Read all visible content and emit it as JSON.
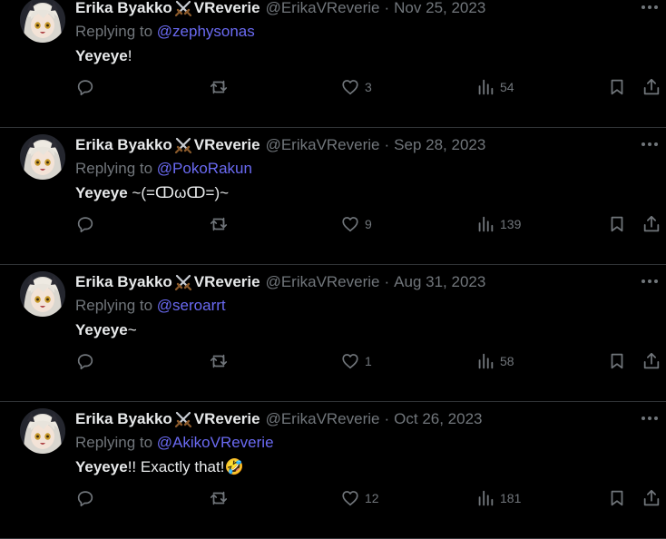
{
  "tweets": [
    {
      "author_name_left": "Erika Byakko",
      "author_name_right": "VReverie",
      "handle": "@ErikaVReverie",
      "separator": "·",
      "date": "Nov 25, 2023",
      "reply_prefix": "Replying to ",
      "reply_to": "@zephysonas",
      "text_bold": "Yeyeye",
      "text_rest": "!",
      "replies": "",
      "retweets": "",
      "likes": "3",
      "views": "54"
    },
    {
      "author_name_left": "Erika Byakko",
      "author_name_right": "VReverie",
      "handle": "@ErikaVReverie",
      "separator": "·",
      "date": "Sep 28, 2023",
      "reply_prefix": "Replying to ",
      "reply_to": "@PokoRakun",
      "text_bold": "Yeyeye",
      "text_rest": " ~(=ↀωↀ=)~",
      "replies": "",
      "retweets": "",
      "likes": "9",
      "views": "139"
    },
    {
      "author_name_left": "Erika Byakko",
      "author_name_right": "VReverie",
      "handle": "@ErikaVReverie",
      "separator": "·",
      "date": "Aug 31, 2023",
      "reply_prefix": "Replying to ",
      "reply_to": "@seroarrt",
      "text_bold": "Yeyeye",
      "text_rest": "~",
      "replies": "",
      "retweets": "",
      "likes": "1",
      "views": "58"
    },
    {
      "author_name_left": "Erika Byakko",
      "author_name_right": "VReverie",
      "handle": "@ErikaVReverie",
      "separator": "·",
      "date": "Oct 26, 2023",
      "reply_prefix": "Replying to ",
      "reply_to": "@AkikoVReverie",
      "text_bold": "Yeyeye",
      "text_rest": "!! Exactly that!🤣",
      "replies": "",
      "retweets": "",
      "likes": "12",
      "views": "181"
    }
  ],
  "icons": {
    "more": "more-icon",
    "reply": "reply-icon",
    "retweet": "retweet-icon",
    "like": "heart-icon",
    "views": "views-icon",
    "bookmark": "bookmark-icon",
    "share": "share-icon",
    "name_badge": "crossed-swords-icon"
  },
  "colors": {
    "background": "#000000",
    "primary_text": "#e7e9ea",
    "secondary_text": "#71767b",
    "mention": "#6a6af2",
    "divider": "#2f3336"
  }
}
